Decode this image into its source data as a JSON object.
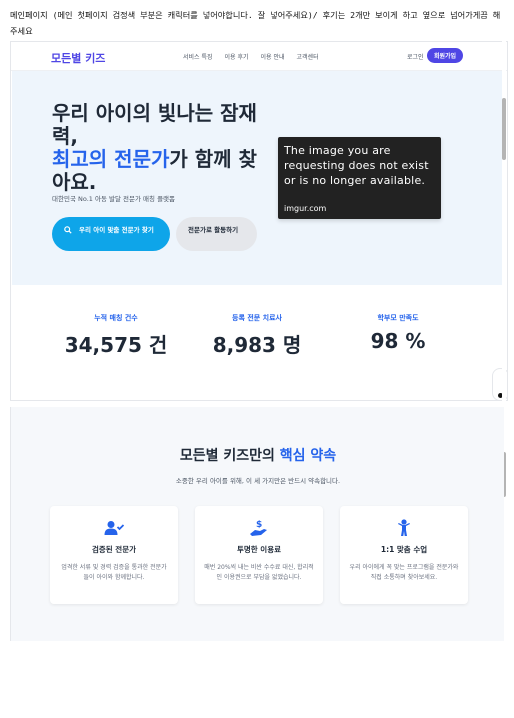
{
  "note": {
    "text": "메인페이지 (메인 첫페이지 검정색 부분은 캐릭터를 넣어야합니다. 잘 넣어주세요)/ 후기는 2개만 보이게 하고 옆으로 넘어가게끔 해주세요"
  },
  "nav": {
    "logo": "모든별 키즈",
    "menu": [
      "서비스 특징",
      "이용 후기",
      "이용 안내",
      "고객센터"
    ],
    "login": "로그인",
    "signup": "회원가입"
  },
  "hero": {
    "title_line1": "우리 아이의 빛나는 잠재력,",
    "title_accent": "최고의 전문가",
    "title_rest": "가 함께 찾아요.",
    "subtitle": "대한민국 No.1 아동 발달 전문가 매칭 플랫폼",
    "primary_button": "우리 아이 맞춤 전문가 찾기",
    "secondary_button": "전문가로 활동하기",
    "image_placeholder": {
      "message": "The image you are requesting does not exist or is no longer available.",
      "source": "imgur.com"
    }
  },
  "stats": [
    {
      "label": "누적 매칭 건수",
      "value": "34,575 건"
    },
    {
      "label": "등록 전문 치료사",
      "value": "8,983 명"
    },
    {
      "label": "학부모 만족도",
      "value": "98 %"
    }
  ],
  "promise": {
    "title_plain": "모든별 키즈만의 ",
    "title_accent": "핵심 약속",
    "subtitle": "소중한 우리 아이를 위해, 이 세 가지만은 반드시 약속합니다.",
    "cards": [
      {
        "icon": "user-check-icon",
        "title": "검증된 전문가",
        "desc": "엄격한 서류 및 경력 검증을 통과한 전문가들이 아이와 함께합니다."
      },
      {
        "icon": "dollar-hand-icon",
        "title": "투명한 이용료",
        "desc": "매번 20%씩 내는 비싼 수수료 대신, 합리적인 이용권으로 부담을 없앴습니다."
      },
      {
        "icon": "child-icon",
        "title": "1:1 맞춤 수업",
        "desc": "우리 아이에게 꼭 맞는 프로그램을 전문가와 직접 소통하며 찾아보세요."
      }
    ]
  },
  "colors": {
    "brand": "#4f46e5",
    "accent": "#2563eb",
    "primary_button": "#0ea5e9",
    "hero_bg": "#eef5fc"
  }
}
